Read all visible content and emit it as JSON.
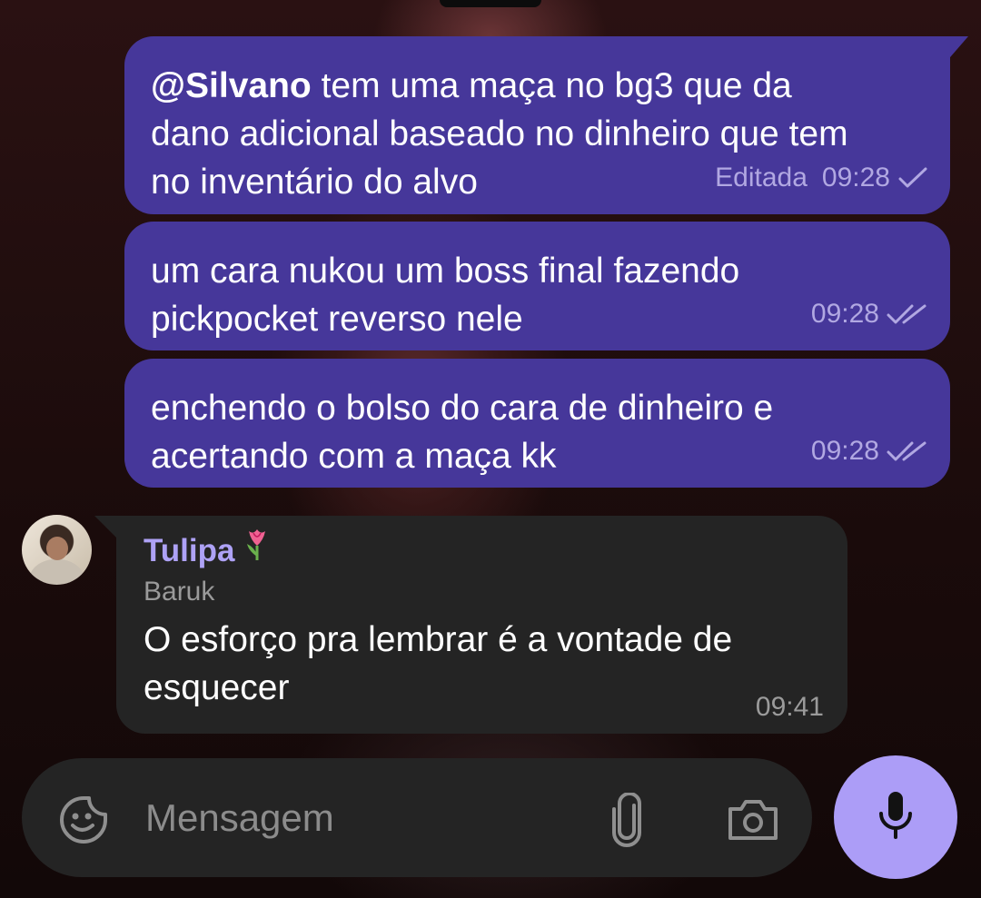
{
  "messages_out": [
    {
      "mention": "@Silvano",
      "text": " tem uma maça no bg3 que da dano adicional baseado no dinheiro que tem no inventário do alvo",
      "edited_label": "Editada",
      "time": "09:28",
      "status": "check-icon"
    },
    {
      "text": "um cara nukou um boss final fazendo pickpocket reverso nele",
      "time": "09:28",
      "status": "double-check-icon"
    },
    {
      "text": "enchendo o bolso do cara de dinheiro e acertando com a maça kk",
      "time": "09:28",
      "status": "double-check-icon"
    }
  ],
  "message_in": {
    "sender": "Tulipa",
    "sender_emoji": "tulip-icon",
    "forwarded_from": "Baruk",
    "text": "O esforço pra lembrar é a vontade de esquecer",
    "time": "09:41"
  },
  "composer": {
    "placeholder": "Mensagem"
  },
  "colors": {
    "outgoing_bubble": "#46379a",
    "incoming_bubble": "#242424",
    "sender_name": "#aea2f6",
    "mic_button": "#ac9df7"
  }
}
